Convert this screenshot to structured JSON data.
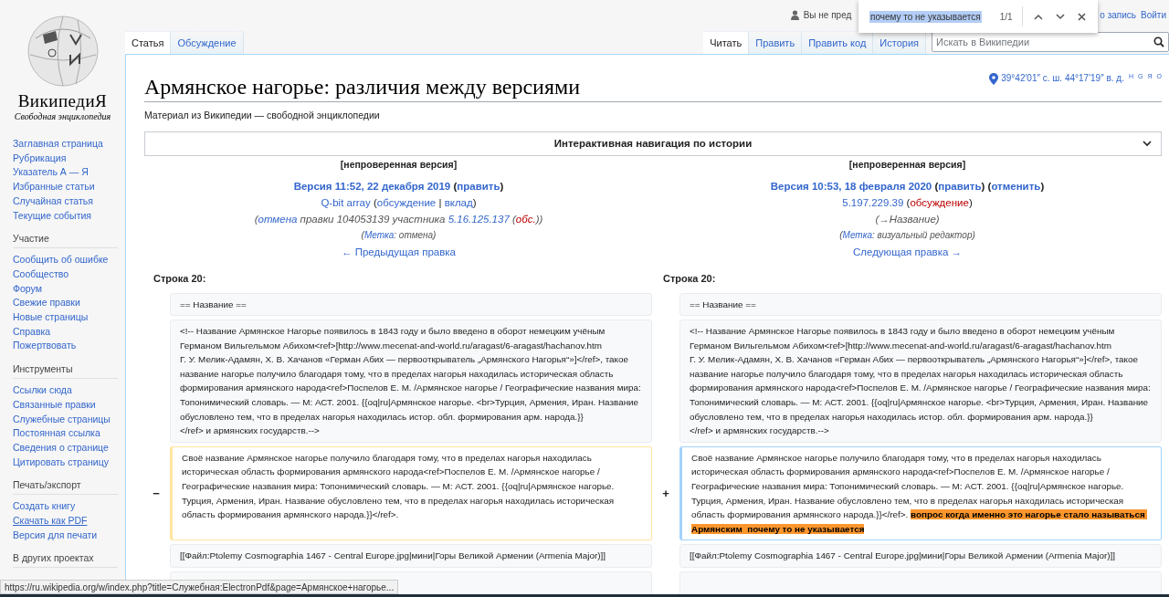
{
  "personal": {
    "user_text": "Вы не пред",
    "links": [
      "о запись",
      "Войти"
    ]
  },
  "find_bar": {
    "query": "почему то не указывается",
    "count": "1/1"
  },
  "logo": {
    "name": "ВикипедиЯ",
    "tagline": "Свободная энциклопедия"
  },
  "sidebar": [
    {
      "items": [
        {
          "label": "Заглавная страница",
          "hovered": false
        },
        {
          "label": "Рубрикация",
          "hovered": false
        },
        {
          "label": "Указатель А — Я",
          "hovered": false
        },
        {
          "label": "Избранные статьи",
          "hovered": false
        },
        {
          "label": "Случайная статья",
          "hovered": false
        },
        {
          "label": "Текущие события",
          "hovered": false
        }
      ]
    },
    {
      "heading": "Участие",
      "items": [
        {
          "label": "Сообщить об ошибке",
          "hovered": false
        },
        {
          "label": "Сообщество",
          "hovered": false
        },
        {
          "label": "Форум",
          "hovered": false
        },
        {
          "label": "Свежие правки",
          "hovered": false
        },
        {
          "label": "Новые страницы",
          "hovered": false
        },
        {
          "label": "Справка",
          "hovered": false
        },
        {
          "label": "Пожертвовать",
          "hovered": false
        }
      ]
    },
    {
      "heading": "Инструменты",
      "items": [
        {
          "label": "Ссылки сюда",
          "hovered": false
        },
        {
          "label": "Связанные правки",
          "hovered": false
        },
        {
          "label": "Служебные страницы",
          "hovered": false
        },
        {
          "label": "Постоянная ссылка",
          "hovered": false
        },
        {
          "label": "Сведения о странице",
          "hovered": false
        },
        {
          "label": "Цитировать страницу",
          "hovered": false
        }
      ]
    },
    {
      "heading": "Печать/экспорт",
      "items": [
        {
          "label": "Создать книгу",
          "hovered": false
        },
        {
          "label": "Скачать как PDF",
          "hovered": true
        },
        {
          "label": "Версия для печати",
          "hovered": false
        }
      ]
    },
    {
      "heading": "В других проектах"
    }
  ],
  "tabs_left": [
    {
      "label": "Статья",
      "selected": true
    },
    {
      "label": "Обсуждение",
      "selected": false
    }
  ],
  "tabs_right": [
    {
      "label": "Читать",
      "selected": true
    },
    {
      "label": "Править",
      "selected": false
    },
    {
      "label": "Править код",
      "selected": false
    },
    {
      "label": "История",
      "selected": false
    }
  ],
  "search": {
    "placeholder": "Искать в Википедии"
  },
  "title": "Армянское нагорье: различия между версиями",
  "coordinates": {
    "text": "39°42′01″ с. ш. 44°17′19″ в. д.",
    "links": [
      "H",
      "G",
      "Я",
      "O"
    ]
  },
  "subtitle": "Материал из Википедии — свободной энциклопедии",
  "history_nav": {
    "title": "Интерактивная навигация по истории",
    "expanded": false
  },
  "versions": [
    {
      "lines": [
        {
          "parts": [
            {
              "kind": "plain",
              "text": "[непроверенная версия]"
            }
          ]
        },
        {
          "parts": [
            {
              "kind": "link",
              "text": "Версия 11:52, 22 декабря 2019"
            },
            {
              "kind": "plain",
              "text": " ("
            },
            {
              "kind": "link",
              "text": "править"
            },
            {
              "kind": "plain",
              "text": ")"
            }
          ]
        },
        {
          "parts": [
            {
              "kind": "link",
              "text": "Q-bit array"
            },
            {
              "kind": "plain",
              "text": " ("
            },
            {
              "kind": "link",
              "text": "обсуждение"
            },
            {
              "kind": "plain",
              "text": " | "
            },
            {
              "kind": "link",
              "text": "вклад"
            },
            {
              "kind": "plain",
              "text": ")"
            }
          ]
        },
        {
          "parts": [
            {
              "kind": "plain",
              "text": "("
            },
            {
              "kind": "link",
              "text": "отмена"
            },
            {
              "kind": "plain",
              "text": " правки 104053139 участника "
            },
            {
              "kind": "link",
              "text": "5.16.125.137"
            },
            {
              "kind": "plain",
              "text": " ("
            },
            {
              "kind": "redlink",
              "text": "обс."
            },
            {
              "kind": "plain",
              "text": "))"
            }
          ]
        },
        {
          "parts": [
            {
              "kind": "plain",
              "text": "("
            },
            {
              "kind": "link",
              "text": "Метка"
            },
            {
              "kind": "plain",
              "text": ": отмена)"
            }
          ]
        },
        {
          "parts": [
            {
              "kind": "link",
              "text": "← Предыдущая правка"
            }
          ]
        }
      ]
    },
    {
      "lines": [
        {
          "parts": [
            {
              "kind": "plain",
              "text": "[непроверенная версия]"
            }
          ]
        },
        {
          "parts": [
            {
              "kind": "link",
              "text": "Версия 10:53, 18 февраля 2020"
            },
            {
              "kind": "plain",
              "text": " ("
            },
            {
              "kind": "link",
              "text": "править"
            },
            {
              "kind": "plain",
              "text": ") ("
            },
            {
              "kind": "link",
              "text": "отменить"
            },
            {
              "kind": "plain",
              "text": ")"
            }
          ]
        },
        {
          "parts": [
            {
              "kind": "link",
              "text": "5.197.229.39"
            },
            {
              "kind": "plain",
              "text": " ("
            },
            {
              "kind": "redlink",
              "text": "обсуждение"
            },
            {
              "kind": "plain",
              "text": ")"
            }
          ]
        },
        {
          "parts": [
            {
              "kind": "plain",
              "text": "(→Название)"
            }
          ]
        },
        {
          "parts": [
            {
              "kind": "plain",
              "text": "("
            },
            {
              "kind": "link",
              "text": "Метка"
            },
            {
              "kind": "plain",
              "text": ": визуальный редактор)"
            }
          ]
        },
        {
          "parts": [
            {
              "kind": "link",
              "text": "Следующая правка →"
            }
          ]
        }
      ]
    }
  ],
  "diff": {
    "left_label": "Строка 20:",
    "right_label": "Строка 20:",
    "rows": [
      {
        "kind": "context",
        "left": "== Название ==",
        "right": "== Название =="
      },
      {
        "kind": "context",
        "left": "<!-- Название Армянское Нагорье появилось в 1843 году и было введено в оборот немецким учёным Германом Вильгельмом Абихом<ref>[http://www.mecenat-and-world.ru/aragast/6-aragast/hachanov.htm\nГ. У. Мелик-Адамян, Х. В. Хачанов «Герман Абих — первооткрыватель „Армянского Нагорья“»]</ref>, такое название нагорье получило благодаря тому, что в пределах нагорья находилась историческая область формирования армянского народа<ref>Поспелов Е. М. /Армянское нагорье / Географические названия мира: Топонимический словарь. — М: АСТ. 2001. {{oq|ru|Армянское нагорье. <br>Турция, Армения, Иран. Название обусловлено тем, что в пределах нагорья находилась истор. обл. формирования арм. народа.}}\n</ref> и армянских государств.-->",
        "right": "<!-- Название Армянское Нагорье появилось в 1843 году и было введено в оборот немецким учёным Германом Вильгельмом Абихом<ref>[http://www.mecenat-and-world.ru/aragast/6-aragast/hachanov.htm\nГ. У. Мелик-Адамян, Х. В. Хачанов «Герман Абих — первооткрыватель „Армянского Нагорья“»]</ref>, такое название нагорье получило благодаря тому, что в пределах нагорья находилась историческая область формирования армянского народа<ref>Поспелов Е. М. /Армянское нагорье / Географические названия мира: Топонимический словарь. — М: АСТ. 2001. {{oq|ru|Армянское нагорье. <br>Турция, Армения, Иран. Название обусловлено тем, что в пределах нагорья находилась истор. обл. формирования арм. народа.}}\n</ref> и армянских государств.-->"
      },
      {
        "kind": "change",
        "left_marker": "−",
        "left": "Своё название Армянское нагорье получило благодаря тому, что в пределах нагорья находилась историческая область формирования армянского народа<ref>Поспелов Е. М. /Армянское нагорье / Географические названия мира: Топонимический словарь. — М: АСТ. 2001. {{oq|ru|Армянское нагорье. Турция, Армения, Иран. Название обусловлено тем, что в пределах нагорья находилась историческая область формирования армянского народа.}}</ref>.",
        "right_marker": "+",
        "right": "Своё название Армянское нагорье получило благодаря тому, что в пределах нагорья находилась историческая область формирования армянского народа<ref>Поспелов Е. М. /Армянское нагорье / Географические названия мира: Топонимический словарь. — М: АСТ. 2001. {{oq|ru|Армянское нагорье. Турция, Армения, Иран. Название обусловлено тем, что в пределах нагорья находилась историческая область формирования армянского народа.}}</ref>. ",
        "right_inserted": "вопрос когда именно это нагорье стало называться Армянским  почему то не указывается"
      },
      {
        "kind": "context",
        "left": "[[Файл:Ptolemy Cosmographia 1467 - Central Europe.jpg|мини|Горы Великой Армении (Armenia Major)]]",
        "right": "[[Файл:Ptolemy Cosmographia 1467 - Central Europe.jpg|мини|Горы Великой Армении (Armenia Major)]]"
      },
      {
        "kind": "blank"
      }
    ]
  },
  "status_url": "https://ru.wikipedia.org/w/index.php?title=Служебная:ElectronPdf&page=Армянское+нагорье..."
}
